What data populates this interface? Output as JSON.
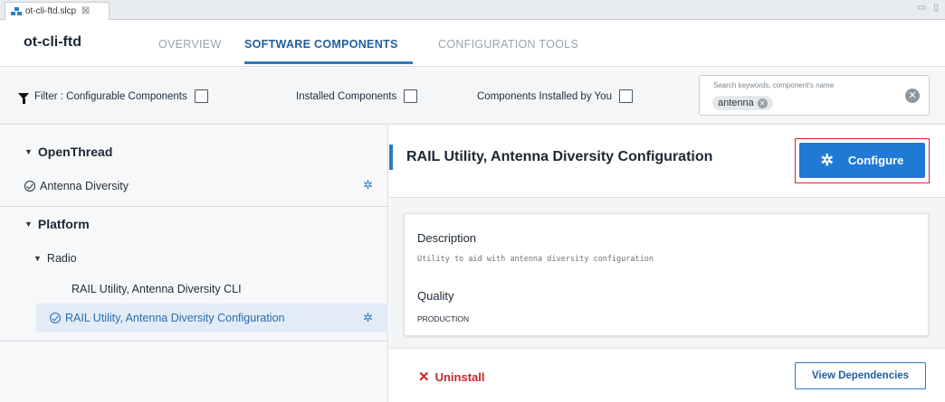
{
  "editor_tab": {
    "label": "ot-cli-ftd.slcp",
    "close": "☒"
  },
  "window_controls": "▭ ▯",
  "header": {
    "project": "ot-cli-ftd",
    "tabs": [
      {
        "label": "OVERVIEW",
        "active": false
      },
      {
        "label": "SOFTWARE COMPONENTS",
        "active": true
      },
      {
        "label": "CONFIGURATION TOOLS",
        "active": false
      }
    ]
  },
  "filters": {
    "configurable": "Filter :  Configurable Components",
    "installed": "Installed Components",
    "installed_by_you": "Components Installed by You"
  },
  "search": {
    "placeholder": "Search keywords, component's name",
    "chip": "antenna"
  },
  "tree": {
    "groups": [
      {
        "label": "OpenThread",
        "items": [
          {
            "label": "Antenna Diversity"
          }
        ]
      },
      {
        "label": "Platform",
        "subgroup": "Radio",
        "items": [
          {
            "label": "RAIL Utility, Antenna Diversity CLI"
          },
          {
            "label": "RAIL Utility, Antenna Diversity Configuration"
          }
        ]
      }
    ]
  },
  "component": {
    "title": "RAIL Utility, Antenna Diversity Configuration",
    "configure_label": "Configure",
    "description_label": "Description",
    "description": "Utility to aid with antenna diversity configuration",
    "quality_label": "Quality",
    "quality": "PRODUCTION",
    "uninstall_label": "Uninstall",
    "dependencies_label": "View Dependencies"
  },
  "colors": {
    "accent": "#2b79c2",
    "primary_button": "#1f7ad4",
    "danger": "#c62828",
    "highlight_frame": "#d1282f"
  }
}
